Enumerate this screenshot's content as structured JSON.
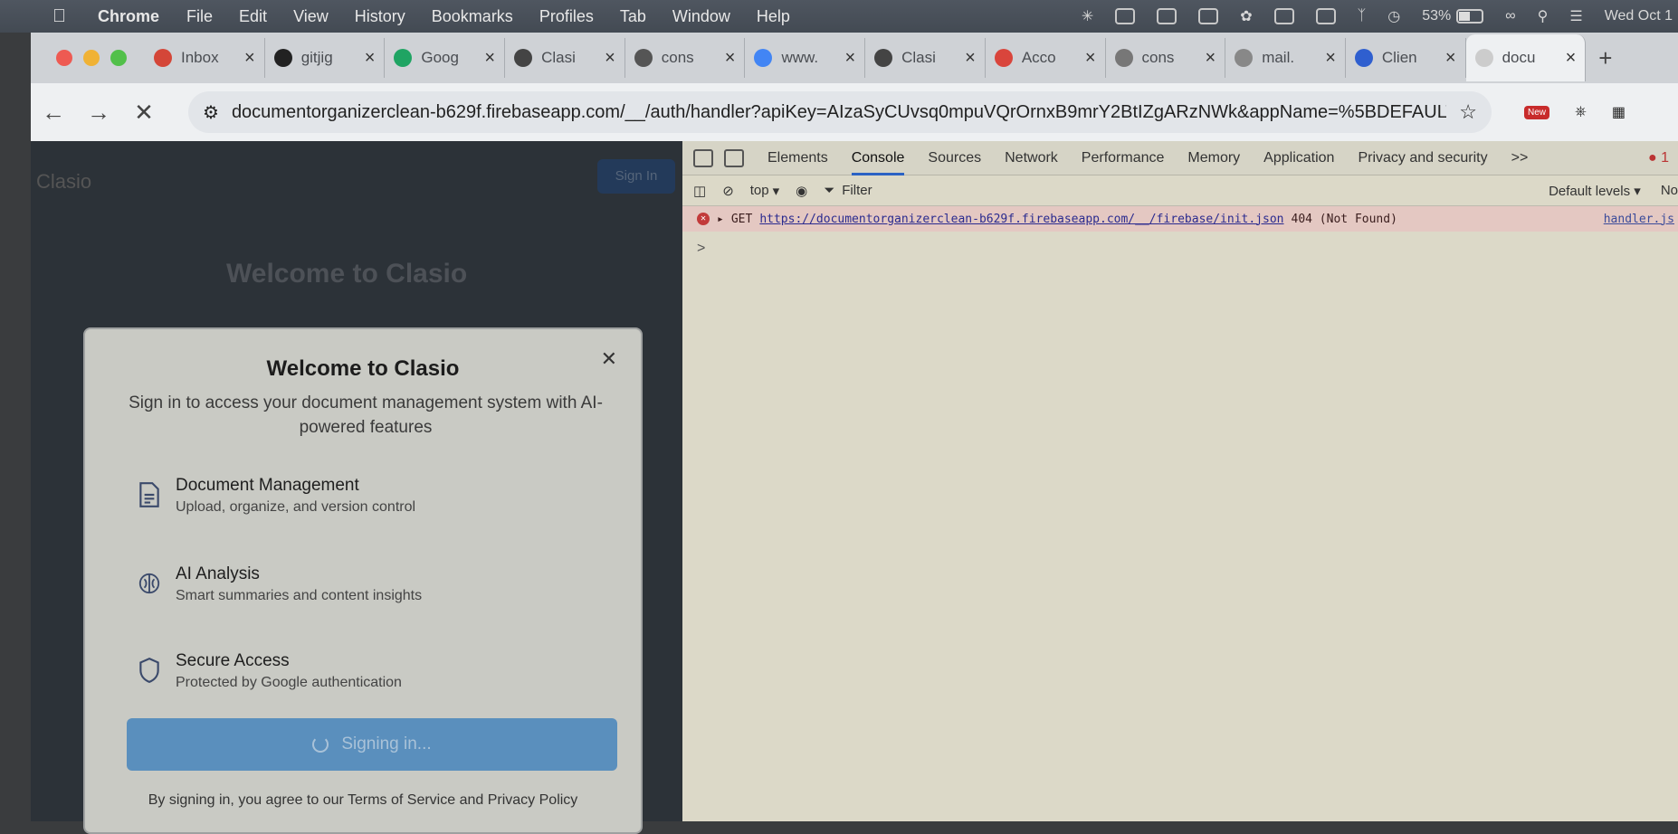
{
  "menubar": {
    "app": "Chrome",
    "items": [
      "File",
      "Edit",
      "View",
      "History",
      "Bookmarks",
      "Profiles",
      "Tab",
      "Window",
      "Help"
    ],
    "battery": "53%",
    "clock": "Wed Oct 1"
  },
  "tabs": [
    {
      "label": "Inbox",
      "icon_color": "#d44638"
    },
    {
      "label": "gitjig",
      "icon_color": "#222222"
    },
    {
      "label": "Goog",
      "icon_color": "#1fa463"
    },
    {
      "label": "Clasi",
      "icon_color": "#444444"
    },
    {
      "label": "cons",
      "icon_color": "#555555"
    },
    {
      "label": "www.",
      "icon_color": "#4285f4"
    },
    {
      "label": "Clasi",
      "icon_color": "#444444"
    },
    {
      "label": "Acco",
      "icon_color": "#d9453c"
    },
    {
      "label": "cons",
      "icon_color": "#777777"
    },
    {
      "label": "mail.",
      "icon_color": "#888888"
    },
    {
      "label": "Clien",
      "icon_color": "#2f5fcf"
    },
    {
      "label": "docu",
      "icon_color": "#cccccc",
      "active": true
    }
  ],
  "toolbar": {
    "url": "documentorganizerclean-b629f.firebaseapp.com/__/auth/handler?apiKey=AIzaSyCUvsq0mpuVQrOrnxB9mrY2BtIZgARzNWk&appName=%5BDEFAULT...",
    "new_badge": "New"
  },
  "site": {
    "logo": "Clasio",
    "signin": "Sign In",
    "title": "Welcome to Clasio"
  },
  "modal": {
    "title": "Welcome to Clasio",
    "subtitle": "Sign in to access your document management system with AI-powered features",
    "features": [
      {
        "title": "Document Management",
        "desc": "Upload, organize, and version control",
        "icon": "document-icon"
      },
      {
        "title": "AI Analysis",
        "desc": "Smart summaries and content insights",
        "icon": "brain-icon"
      },
      {
        "title": "Secure Access",
        "desc": "Protected by Google authentication",
        "icon": "shield-icon"
      }
    ],
    "button": "Signing in...",
    "terms": "By signing in, you agree to our Terms of Service and Privacy Policy"
  },
  "devtools": {
    "tabs": [
      "Elements",
      "Console",
      "Sources",
      "Network",
      "Performance",
      "Memory",
      "Application",
      "Privacy and security"
    ],
    "active_tab": "Console",
    "more": ">>",
    "error_count": "1",
    "context": "top",
    "filter_placeholder": "Filter",
    "levels": "Default levels",
    "no_issues": "No",
    "message": {
      "method": "GET",
      "url": "https://documentorganizerclean-b629f.firebaseapp.com/__/firebase/init.json",
      "status": "404 (Not Found)",
      "source": "handler.js"
    },
    "prompt": ">"
  }
}
